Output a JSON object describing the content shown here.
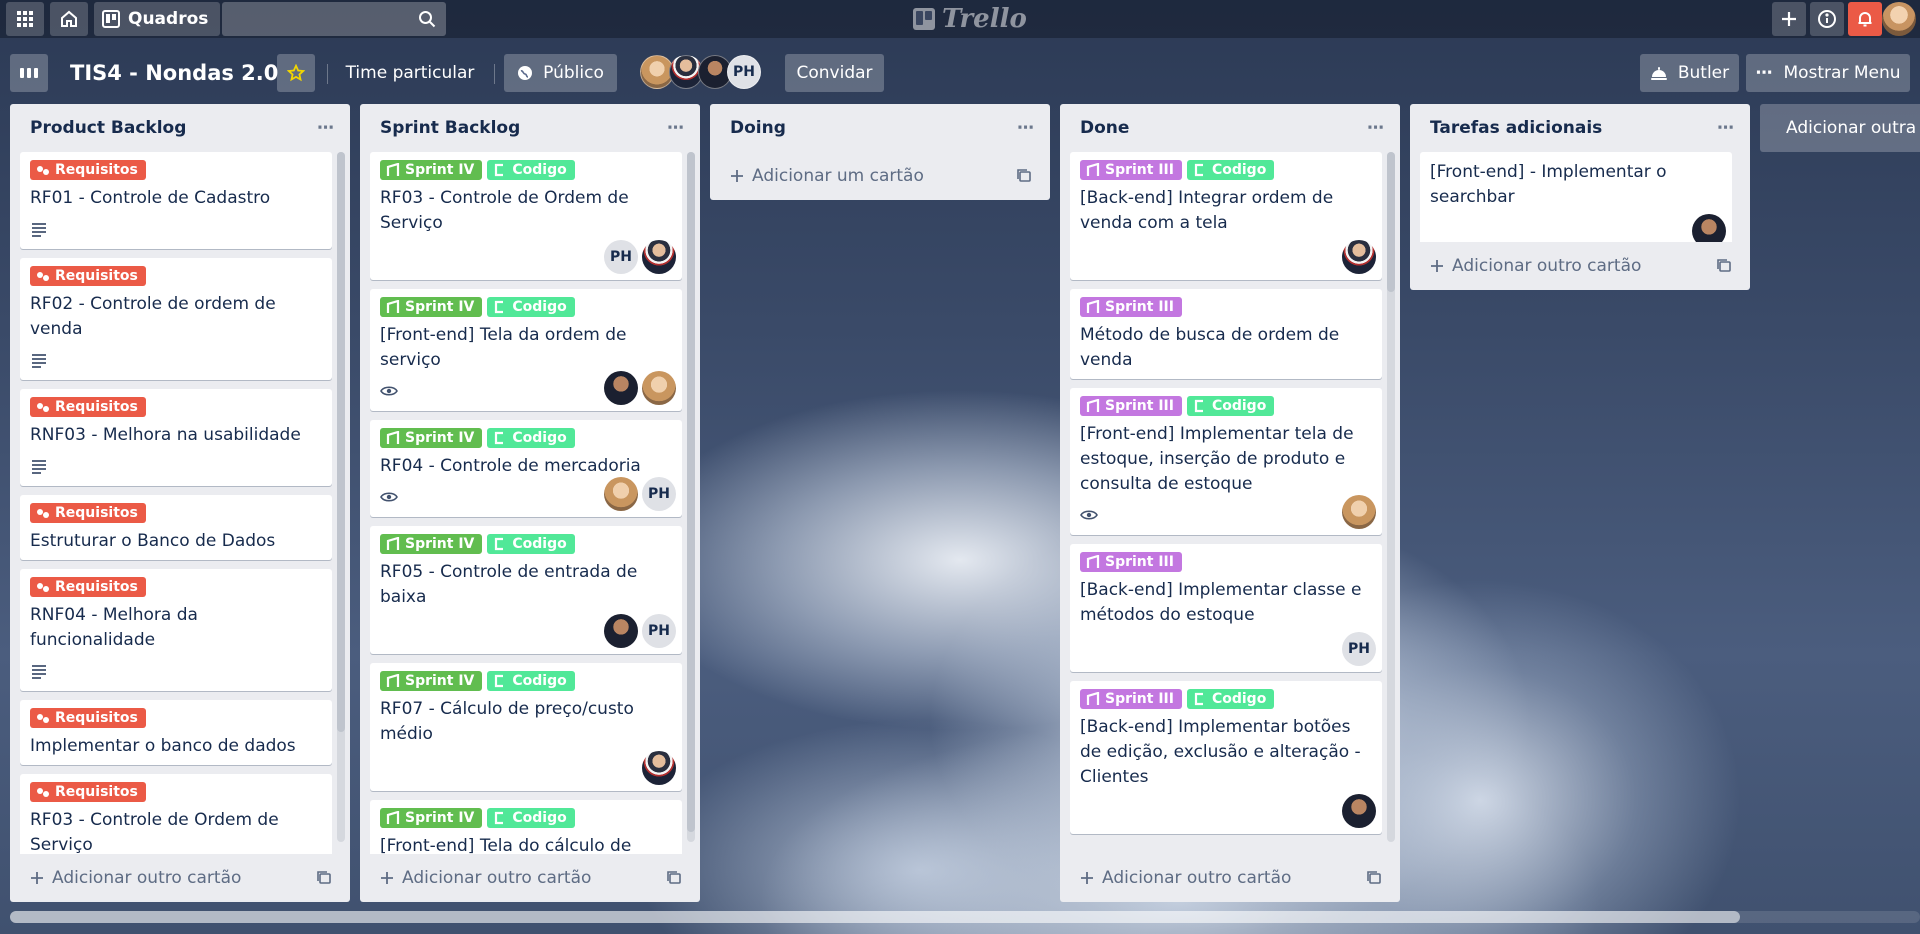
{
  "app": {
    "brand": "Trello"
  },
  "header": {
    "boards_label": "Quadros",
    "search": {
      "value": "",
      "placeholder": ""
    },
    "icons": [
      "apps-grid-icon",
      "home-icon",
      "boards-icon",
      "search-icon",
      "plus-icon",
      "info-icon",
      "bell-icon"
    ]
  },
  "board": {
    "title": "TIS4 - Nondas 2.0",
    "team": "Time particular",
    "visibility": "Público",
    "invite": "Convidar",
    "butler": "Butler",
    "menu": "Mostrar Menu",
    "members": [
      "photo",
      "photo",
      "photo",
      "PH"
    ]
  },
  "colors": {
    "requisitos": "#eb5a46",
    "sprint_iv": "#61bd4f",
    "sprint_iii": "#c377e0",
    "codigo": "#51e898",
    "alert": "#eb5a46"
  },
  "labels": {
    "requisitos": "Requisitos",
    "sprint_iv": "Sprint IV",
    "sprint_iii": "Sprint III",
    "codigo": "Codigo"
  },
  "lists": [
    {
      "title": "Product Backlog",
      "add_label": "Adicionar outro cartão",
      "cards": [
        {
          "labels": [
            "Requisitos"
          ],
          "title": "RF01 - Controle de Cadastro",
          "badge": "description",
          "members": []
        },
        {
          "labels": [
            "Requisitos"
          ],
          "title": "RF02 - Controle de ordem de venda",
          "badge": "description",
          "members": []
        },
        {
          "labels": [
            "Requisitos"
          ],
          "title": "RNF03 - Melhora na usabilidade",
          "badge": "description",
          "members": []
        },
        {
          "labels": [
            "Requisitos"
          ],
          "title": "Estruturar o Banco de Dados",
          "badge": "",
          "members": []
        },
        {
          "labels": [
            "Requisitos"
          ],
          "title": "RNF04 - Melhora da funcionalidade",
          "badge": "description",
          "members": []
        },
        {
          "labels": [
            "Requisitos"
          ],
          "title": "Implementar o banco de dados",
          "badge": "",
          "members": []
        },
        {
          "labels": [
            "Requisitos"
          ],
          "title": "RF03 - Controle de Ordem de Serviço",
          "badge": "",
          "members": []
        },
        {
          "labels": [
            "Requisitos"
          ],
          "title": "",
          "badge": "",
          "members": []
        }
      ]
    },
    {
      "title": "Sprint Backlog",
      "add_label": "Adicionar outro cartão",
      "cards": [
        {
          "labels": [
            "Sprint IV",
            "Codigo"
          ],
          "title": "RF03 - Controle de Ordem de Serviço",
          "badge": "",
          "members": [
            "PH",
            "suit"
          ]
        },
        {
          "labels": [
            "Sprint IV",
            "Codigo"
          ],
          "title": "[Front-end] Tela da ordem de serviço",
          "badge": "watch",
          "members": [
            "dark",
            "fair"
          ]
        },
        {
          "labels": [
            "Sprint IV",
            "Codigo"
          ],
          "title": "RF04 - Controle de mercadoria",
          "badge": "watch",
          "members": [
            "fair",
            "PH"
          ]
        },
        {
          "labels": [
            "Sprint IV",
            "Codigo"
          ],
          "title": "RF05 - Controle de entrada de baixa",
          "badge": "",
          "members": [
            "dark",
            "PH"
          ]
        },
        {
          "labels": [
            "Sprint IV",
            "Codigo"
          ],
          "title": "RF07 - Cálculo de preço/custo médio",
          "badge": "",
          "members": [
            "suit"
          ]
        },
        {
          "labels": [
            "Sprint IV",
            "Codigo"
          ],
          "title": "[Front-end] Tela do cálculo de preço/custo médio",
          "badge": "watch",
          "members": [
            "dark",
            "fair"
          ]
        }
      ]
    },
    {
      "title": "Doing",
      "add_label": "Adicionar um cartão",
      "cards": []
    },
    {
      "title": "Done",
      "add_label": "Adicionar outro cartão",
      "cards": [
        {
          "labels": [
            "Sprint III",
            "Codigo"
          ],
          "title": "[Back-end] Integrar ordem de venda com a tela",
          "badge": "",
          "members": [
            "suit"
          ]
        },
        {
          "labels": [
            "Sprint III"
          ],
          "title": "Método de busca de ordem de venda",
          "badge": "",
          "members": []
        },
        {
          "labels": [
            "Sprint III",
            "Codigo"
          ],
          "title": "[Front-end] Implementar tela de estoque, inserção de produto e consulta de estoque",
          "badge": "watch",
          "members": [
            "fair"
          ]
        },
        {
          "labels": [
            "Sprint III"
          ],
          "title": "[Back-end] Implementar classe e métodos do estoque",
          "badge": "",
          "members": [
            "PH"
          ]
        },
        {
          "labels": [
            "Sprint III",
            "Codigo"
          ],
          "title": "[Back-end] Implementar botões de edição, exclusão e alteração - Clientes",
          "badge": "",
          "members": [
            "dark"
          ]
        }
      ]
    },
    {
      "title": "Tarefas adicionais",
      "add_label": "Adicionar outro cartão",
      "cards": [
        {
          "labels": [],
          "title": "[Front-end] - Implementar o searchbar",
          "badge": "",
          "members": [
            "dark"
          ]
        }
      ]
    }
  ],
  "add_list_label": "Adicionar outra lista"
}
